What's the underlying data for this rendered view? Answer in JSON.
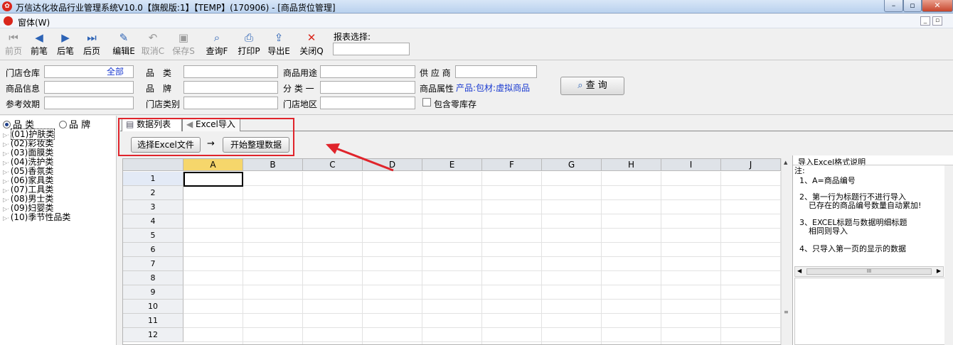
{
  "window": {
    "title": "万信达化妆品行业管理系统V10.0【旗舰版:1】【TEMP】(170906) - [商品货位管理]",
    "logo": "app-logo",
    "min": "–",
    "max": "▫",
    "close": "✕"
  },
  "menu": {
    "window_label": "窗体(W)",
    "mdi_min": "_",
    "mdi_restore": "▫"
  },
  "toolbar": {
    "buttons": [
      {
        "label": "前页",
        "icon": "first-page-icon",
        "glyph": "⏮",
        "enabled": false
      },
      {
        "label": "前笔",
        "icon": "prev-icon",
        "glyph": "◀",
        "enabled": true
      },
      {
        "label": "后笔",
        "icon": "next-icon",
        "glyph": "▶",
        "enabled": true
      },
      {
        "label": "后页",
        "icon": "last-page-icon",
        "glyph": "⏭",
        "enabled": true
      },
      {
        "label": "编辑E",
        "icon": "edit-icon",
        "glyph": "✎",
        "enabled": true
      },
      {
        "label": "取消C",
        "icon": "undo-icon",
        "glyph": "↶",
        "enabled": false
      },
      {
        "label": "保存S",
        "icon": "save-icon",
        "glyph": "▣",
        "enabled": false
      },
      {
        "label": "查询F",
        "icon": "search-icon",
        "glyph": "⌕",
        "enabled": true
      },
      {
        "label": "打印P",
        "icon": "print-icon",
        "glyph": "⎙",
        "enabled": true
      },
      {
        "label": "导出E",
        "icon": "export-icon",
        "glyph": "⇪",
        "enabled": true
      },
      {
        "label": "关闭Q",
        "icon": "close-icon",
        "glyph": "✕",
        "enabled": true
      }
    ],
    "report_select_label": "报表选择:",
    "report_select_value": ""
  },
  "filters": {
    "store_warehouse_label": "门店仓库",
    "all_link": "全部",
    "category_label": "品　类",
    "usage_label": "商品用途",
    "supplier_label": "供 应 商",
    "product_info_label": "商品信息",
    "brand_label": "品　牌",
    "class1_label": "分 类 一",
    "product_attr_label": "商品属性",
    "product_attr_value": "产品:包材:虚拟商品",
    "reference_expiry_label": "参考效期",
    "store_type_label": "门店类别",
    "store_region_label": "门店地区",
    "include_zero_stock_label": "包含零库存",
    "query_button": "查 询"
  },
  "tree": {
    "radio_category": "品 类",
    "radio_brand": "品 牌",
    "items": [
      "(01)护肤类",
      "(02)彩妆类",
      "(03)面膜类",
      "(04)洗护类",
      "(05)香氛类",
      "(06)家具类",
      "(07)工具类",
      "(08)男士类",
      "(09)妇婴类",
      "(10)季节性品类"
    ]
  },
  "tabs": {
    "list": "数据列表",
    "excel": "Excel导入"
  },
  "excel": {
    "select_button": "选择Excel文件",
    "arrow": "→",
    "start_button": "开始整理数据"
  },
  "grid": {
    "columns": [
      "A",
      "B",
      "C",
      "D",
      "E",
      "F",
      "G",
      "H",
      "I",
      "J"
    ],
    "rows": [
      "1",
      "2",
      "3",
      "4",
      "5",
      "6",
      "7",
      "8",
      "9",
      "10",
      "11",
      "12"
    ]
  },
  "help": {
    "title": "导入Excel格式说明",
    "note": "注:",
    "line1": "1、A=商品编号",
    "line2a": "2、第一行为标题行不进行导入",
    "line2b": "已存在的商品编号数量自动累加!",
    "line3a": "3、EXCEL标题与数据明细标题",
    "line3b": "相同则导入",
    "line4": "4、只导入第一页的显示的数据",
    "scroll_grip": "III"
  },
  "colors": {
    "annotation": "#e0242b",
    "link": "#1a3ad0",
    "selected_col": "#f6d66b"
  }
}
